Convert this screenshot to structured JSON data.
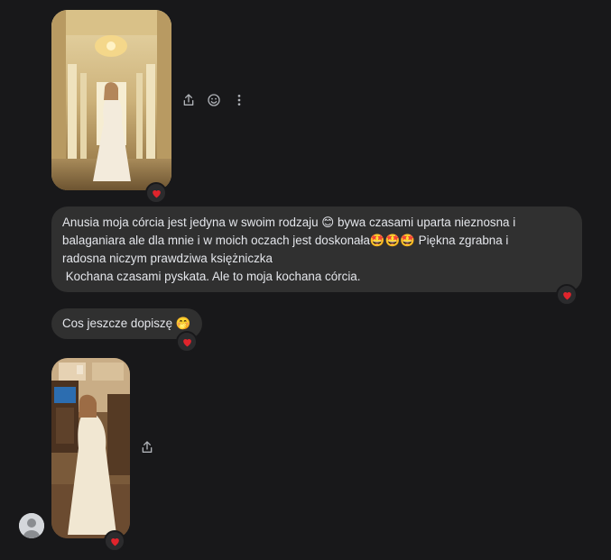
{
  "conversation": {
    "message_1": {
      "type": "photo",
      "reaction": "heart",
      "actions": [
        "share-icon",
        "emoji-react-icon",
        "more-options-icon"
      ]
    },
    "message_2": {
      "type": "text",
      "lines": [
        "Anusia moja córcia jest jedyna w swoim rodzaju 😊 bywa czasami uparta nieznosna i",
        "balaganiara ale dla mnie i w moich oczach jest doskonała🤩🤩🤩 Piękna zgrabna i",
        "radosna niczym prawdziwa księżniczka",
        " Kochana czasami pyskata. Ale to moja kochana córcia."
      ],
      "reaction": "heart"
    },
    "message_3": {
      "type": "text",
      "text": "Cos jeszcze dopiszę 🤭",
      "reaction": "heart"
    },
    "message_4": {
      "type": "photo",
      "reaction": "heart",
      "actions": [
        "share-icon"
      ]
    }
  },
  "colors": {
    "background": "#18181a",
    "bubble": "#303030",
    "text": "#e4e6eb",
    "icon": "#b0b3b8",
    "heart": "#e0242c"
  }
}
